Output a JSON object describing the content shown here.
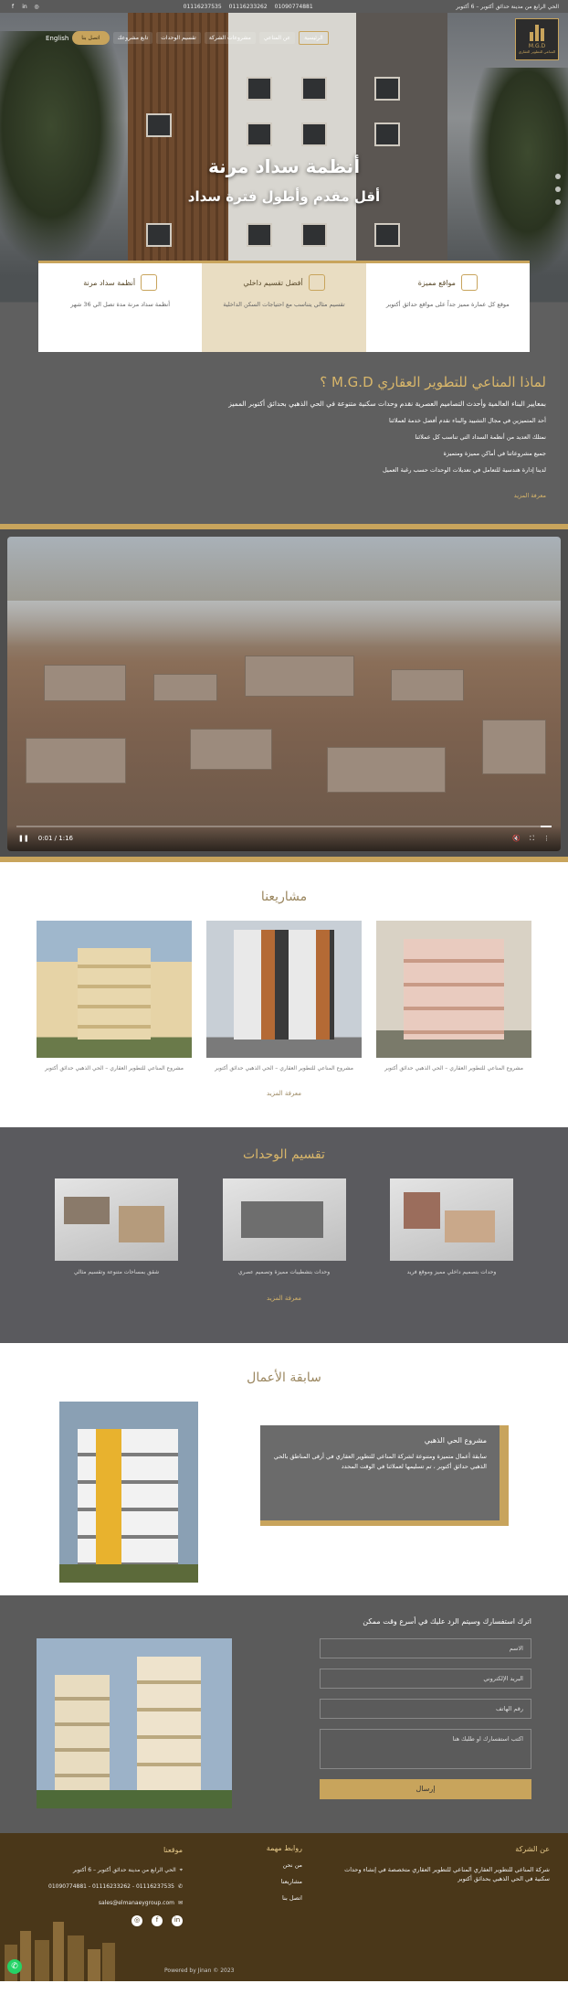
{
  "topbar": {
    "address": "الحي الرابع من مدينة حدائق أكتوبر – 6 أكتوبر",
    "phones": [
      "01116237535",
      "01116233262",
      "01090774881"
    ],
    "social": [
      "f",
      "in",
      "◎"
    ]
  },
  "nav": {
    "logo": "M.G.D",
    "logo_sub": "المناعي للتطوير العقاري",
    "items": [
      "الرئيسية",
      "عن المناعي",
      "مشروعات الشركة",
      "تقسيم الوحدات",
      "تابع مشروعك"
    ],
    "cta": "اتصل بنا",
    "lang": "English"
  },
  "hero": {
    "title": "أنظمة سداد مرنة",
    "subtitle": "أقل مقدم وأطول فترة سداد"
  },
  "features": [
    {
      "title": "مواقع مميزة",
      "desc": "موقع كل عمارة مميز جداً على مواقع حدائق أكتوبر"
    },
    {
      "title": "أفضل تقسيم داخلي",
      "desc": "تقسيم مثالي يتناسب مع احتياجات السكن الداخلية"
    },
    {
      "title": "أنظمة سداد مرنة",
      "desc": "أنظمة سداد مرنة مدة تصل الي 36 شهر"
    }
  ],
  "why": {
    "title": "لماذا المناعي للتطوير العقاري M.G.D ؟",
    "intro": "بمعايير البناء العالمية وأحدث التصاميم العصرية نقدم وحدات سكنية متنوعة في الحي الذهبي بحدائق أكتوبر المميز",
    "points": [
      "أحد المتميزين في مجال التشييد والبناء نقدم أفضل خدمة لعملائنا",
      "نمتلك العديد من أنظمة السداد التي تناسب كل عملائنا",
      "جميع مشروعاتنا في أماكن مميزة ومتميزة",
      "لدينا إدارة هندسية للتعامل في تعديلات الوحدات حسب رغبة العميل"
    ],
    "more": "معرفة المزيد"
  },
  "video": {
    "time": "0:01 / 1:16",
    "progress": 0.02
  },
  "projects": {
    "title": "مشاريعنا",
    "items": [
      {
        "caption": "مشروع المناعي للتطوير العقاري – الحي الذهبي حدائق أكتوبر"
      },
      {
        "caption": "مشروع المناعي للتطوير العقاري – الحي الذهبي حدائق أكتوبر"
      },
      {
        "caption": "مشروع المناعي للتطوير العقاري – الحي الذهبي حدائق أكتوبر"
      }
    ],
    "more": "معرفة المزيد"
  },
  "units": {
    "title": "تقسيم الوحدات",
    "items": [
      {
        "caption": "شقق بمساحات متنوعة وتقسيم مثالي"
      },
      {
        "caption": "وحدات بتشطيبات مميزة وتصميم عصري"
      },
      {
        "caption": "وحدات بتصميم داخلي مميز وموقع فريد"
      }
    ],
    "more": "معرفة المزيد"
  },
  "works": {
    "title": "سابقة الأعمال",
    "card_title": "مشروع الحي الذهبي",
    "card_text": "سابقة أعمال متميزة ومتنوعة لشركة المناعي للتطوير العقاري في أرقى المناطق بالحي الذهبي حدائق أكتوبر ، تم تسليمها لعملائنا في الوقت المحدد"
  },
  "contact": {
    "title": "اترك استفسارك وسيتم الرد عليك في أسرع وقت ممكن",
    "fields": [
      "الاسم",
      "البريد الإلكتروني",
      "رقم الهاتف",
      "اكتب استفسارك او طلبك هنا"
    ],
    "send": "إرسال"
  },
  "footer": {
    "about_title": "عن الشركة",
    "about_text": "شركة المناعي للتطوير العقاري المناعي للتطوير العقاري متخصصة في إنشاء وحدات سكنية في الحي الذهبي بحدائق أكتوبر",
    "links_title": "روابط مهمة",
    "links": [
      "من نحن",
      "مشاريعنا",
      "اتصل بنا"
    ],
    "loc_title": "موقعنا",
    "address": "الحي الرابع من مدينة حدائق أكتوبر – 6 أكتوبر",
    "phones": "01116237535 - 01116233262 - 01090774881",
    "email": "sales@elmanaeygroup.com",
    "copyright": "Powered by Jinan © 2023"
  }
}
